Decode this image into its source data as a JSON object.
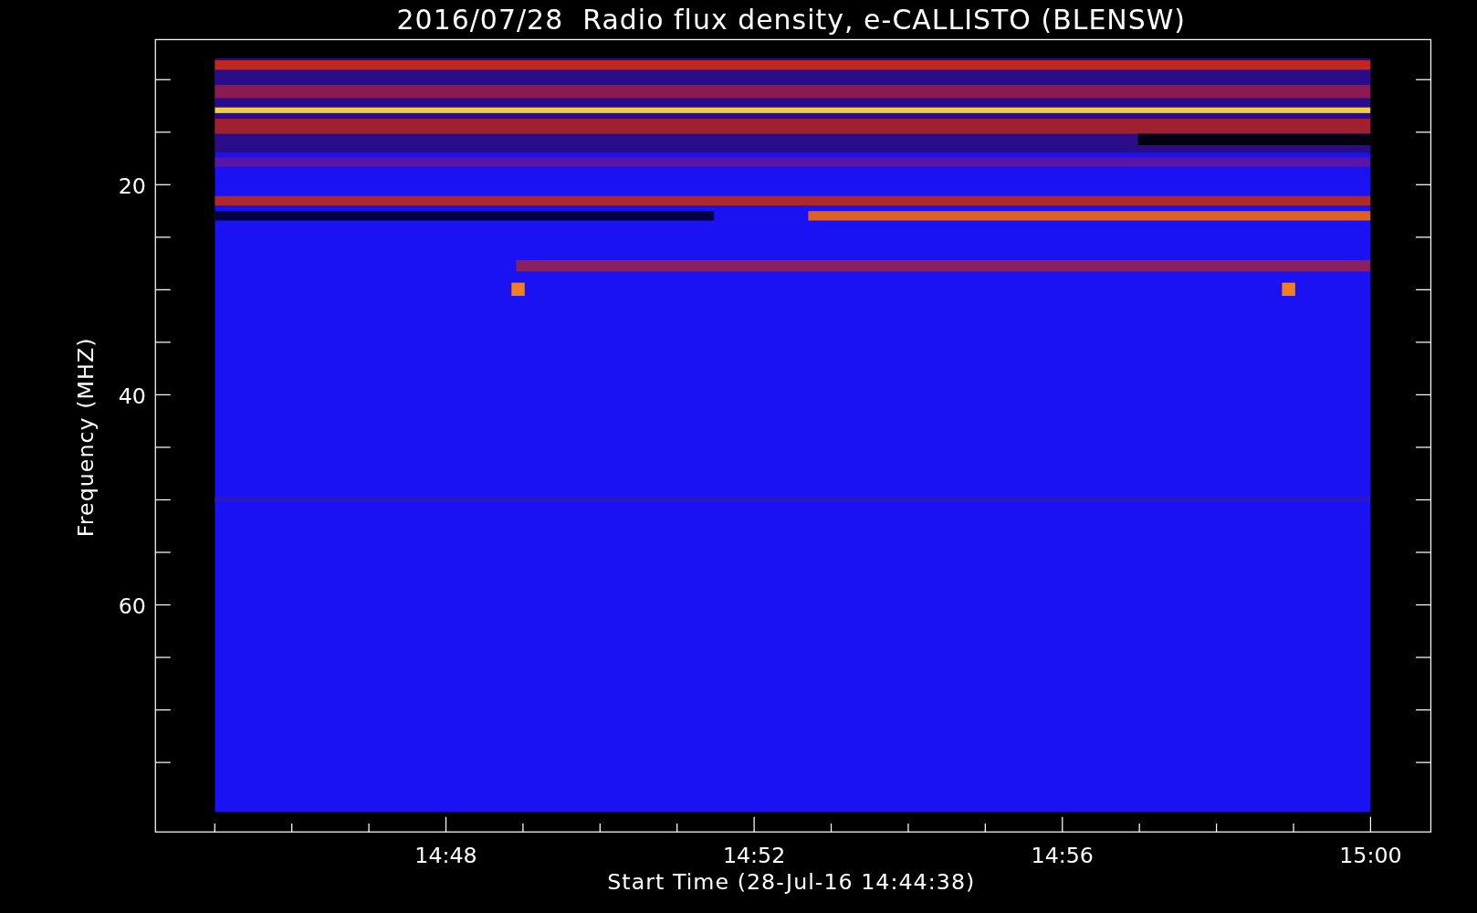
{
  "title": "2016/07/28  Radio flux density, e-CALLISTO (BLENSW)",
  "plot": {
    "ylabel": "Frequency (MHZ)",
    "xlabel": "Start Time (28-Jul-16 14:44:38)",
    "yticks": [
      "20",
      "40",
      "60"
    ],
    "xticks": [
      "14:48",
      "14:52",
      "14:56",
      "15:00"
    ]
  }
}
